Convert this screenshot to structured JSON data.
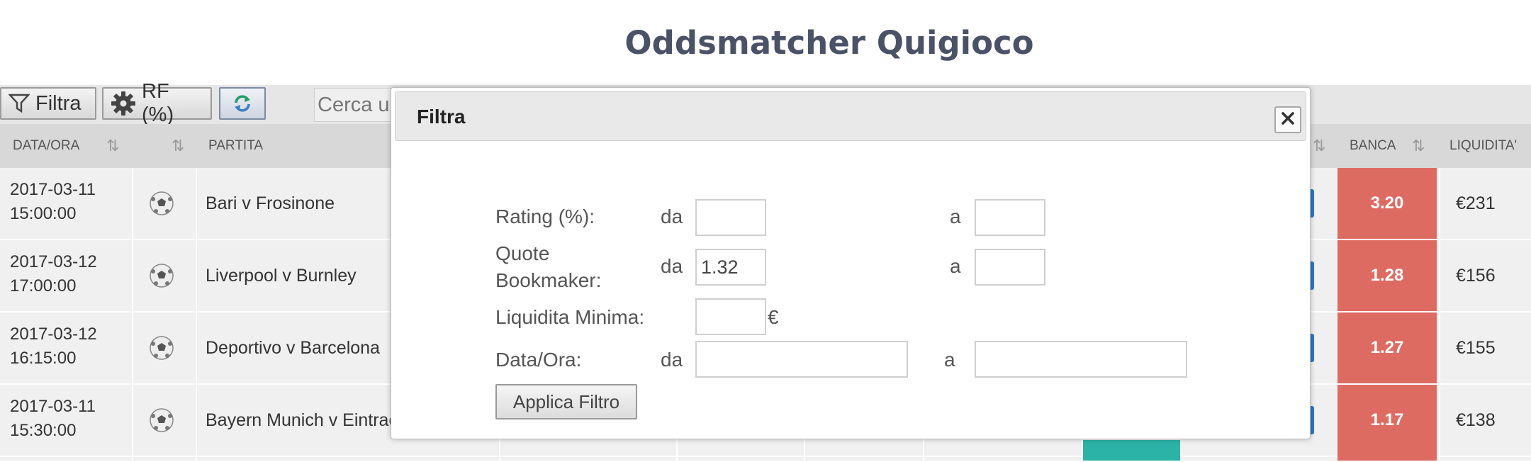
{
  "page": {
    "title": "Oddsmatcher Quigioco"
  },
  "toolbar": {
    "filter_label": "Filtra",
    "rf_label": "RF (%)",
    "search_placeholder": "Cerca un"
  },
  "table": {
    "headers": {
      "date": "DATA/ORA",
      "match": "PARTITA",
      "banca": "BANCA",
      "liquidita": "LIQUIDITA'"
    },
    "rows": [
      {
        "date": "2017-03-11",
        "time": "15:00:00",
        "match": "Bari v Frosinone",
        "banca": "3.20",
        "liquidita": "€231"
      },
      {
        "date": "2017-03-12",
        "time": "17:00:00",
        "match": "Liverpool v Burnley",
        "banca": "1.28",
        "liquidita": "€156"
      },
      {
        "date": "2017-03-12",
        "time": "16:15:00",
        "match": "Deportivo v Barcelona",
        "banca": "1.27",
        "liquidita": "€155"
      },
      {
        "date": "2017-03-11",
        "time": "15:30:00",
        "match": "Bayern Munich v Eintrac",
        "banca": "1.17",
        "liquidita": "€138"
      }
    ]
  },
  "modal": {
    "title": "Filtra",
    "rating_label": "Rating (%):",
    "quote_label_1": "Quote",
    "quote_label_2": "Bookmaker:",
    "liquidita_label": "Liquidita Minima:",
    "data_label": "Data/Ora:",
    "from": "da",
    "to": "a",
    "currency": "€",
    "quote_from_value": "1.32",
    "apply_label": "Applica Filtro"
  },
  "colors": {
    "banca": "#de6b62",
    "title": "#4a5268",
    "teal": "#2ab3a6"
  },
  "icons": {
    "filter": "funnel-icon",
    "settings": "gear-icon",
    "refresh": "refresh-icon",
    "sport": "soccer-ball-icon",
    "sort": "sort-icon",
    "close": "close-icon"
  }
}
